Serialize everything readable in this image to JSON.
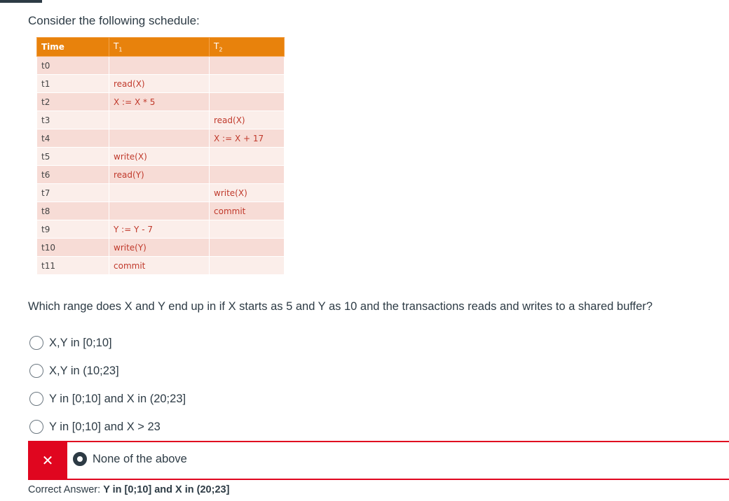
{
  "question_intro": "Consider the following schedule:",
  "schedule": {
    "headers": {
      "time": "Time",
      "t1": "T",
      "t1_sub": "1",
      "t2": "T",
      "t2_sub": "2"
    },
    "rows": [
      {
        "time": "t0",
        "t1": "",
        "t2": ""
      },
      {
        "time": "t1",
        "t1": "read(X)",
        "t2": ""
      },
      {
        "time": "t2",
        "t1": "X := X * 5",
        "t2": ""
      },
      {
        "time": "t3",
        "t1": "",
        "t2": "read(X)"
      },
      {
        "time": "t4",
        "t1": "",
        "t2": "X := X + 17"
      },
      {
        "time": "t5",
        "t1": "write(X)",
        "t2": ""
      },
      {
        "time": "t6",
        "t1": "read(Y)",
        "t2": ""
      },
      {
        "time": "t7",
        "t1": "",
        "t2": "write(X)"
      },
      {
        "time": "t8",
        "t1": "",
        "t2": "commit"
      },
      {
        "time": "t9",
        "t1": "Y := Y - 7",
        "t2": ""
      },
      {
        "time": "t10",
        "t1": "write(Y)",
        "t2": ""
      },
      {
        "time": "t11",
        "t1": "commit",
        "t2": ""
      }
    ]
  },
  "question_text": "Which range does X and Y end up in if X starts as 5 and Y as 10 and the transactions reads and writes to a shared buffer?",
  "options": [
    {
      "label": "X,Y in [0;10]"
    },
    {
      "label": "X,Y in (10;23]"
    },
    {
      "label": "Y in [0;10] and X in (20;23]"
    },
    {
      "label": "Y in [0;10] and X > 23"
    }
  ],
  "selected_answer": {
    "mark": "✕",
    "label": "None of the above"
  },
  "correct_answer": {
    "prefix": "Correct Answer:",
    "value": "Y in [0;10] and X in (20;23]"
  },
  "colors": {
    "header_orange": "#e8820c",
    "wrong_red": "#e0061f",
    "cell_text_red": "#c0392b"
  }
}
